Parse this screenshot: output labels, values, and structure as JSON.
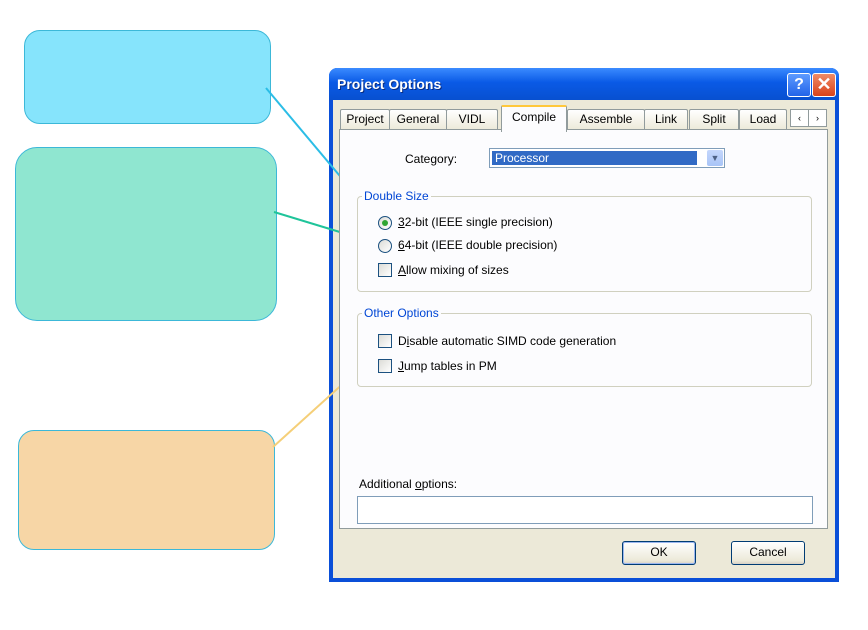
{
  "callouts": [
    "",
    "",
    ""
  ],
  "dialog": {
    "title": "Project Options",
    "help_glyph": "?",
    "close_glyph": "✕",
    "tabs": [
      "Project",
      "General",
      "VIDL",
      "Compile",
      "Assemble",
      "Link",
      "Split",
      "Load"
    ],
    "active_tab": "Compile",
    "tab_scroll": [
      "‹",
      "›"
    ],
    "category_label": "Category:",
    "category_value": "Processor",
    "double_size": {
      "legend": "Double Size",
      "options": [
        {
          "label": "32-bit (IEEE single precision)",
          "selected": true
        },
        {
          "label": "64-bit (IEEE double precision)",
          "selected": false
        }
      ],
      "allow_mixing": {
        "label": "Allow mixing of sizes",
        "checked": false
      }
    },
    "other_options": {
      "legend": "Other Options",
      "items": [
        {
          "label": "Disable automatic SIMD code generation",
          "checked": false
        },
        {
          "label": "Jump tables in PM",
          "checked": false
        }
      ]
    },
    "additional_options_label": "Additional options:",
    "additional_options_value": "",
    "ok_label": "OK",
    "cancel_label": "Cancel"
  },
  "colors": {
    "callout_1": "#86e4fc",
    "callout_2": "#8fe6d0",
    "callout_3": "#f7d6a6",
    "connector_1": "#2bbde6",
    "connector_2": "#1fc49a",
    "connector_3": "#f5cf78",
    "titlebar": "#0a5ae6",
    "selection": "#316ac5"
  },
  "icons": [
    "help-icon",
    "close-icon",
    "chevron-down-icon",
    "tab-scroll-left-icon",
    "tab-scroll-right-icon"
  ]
}
